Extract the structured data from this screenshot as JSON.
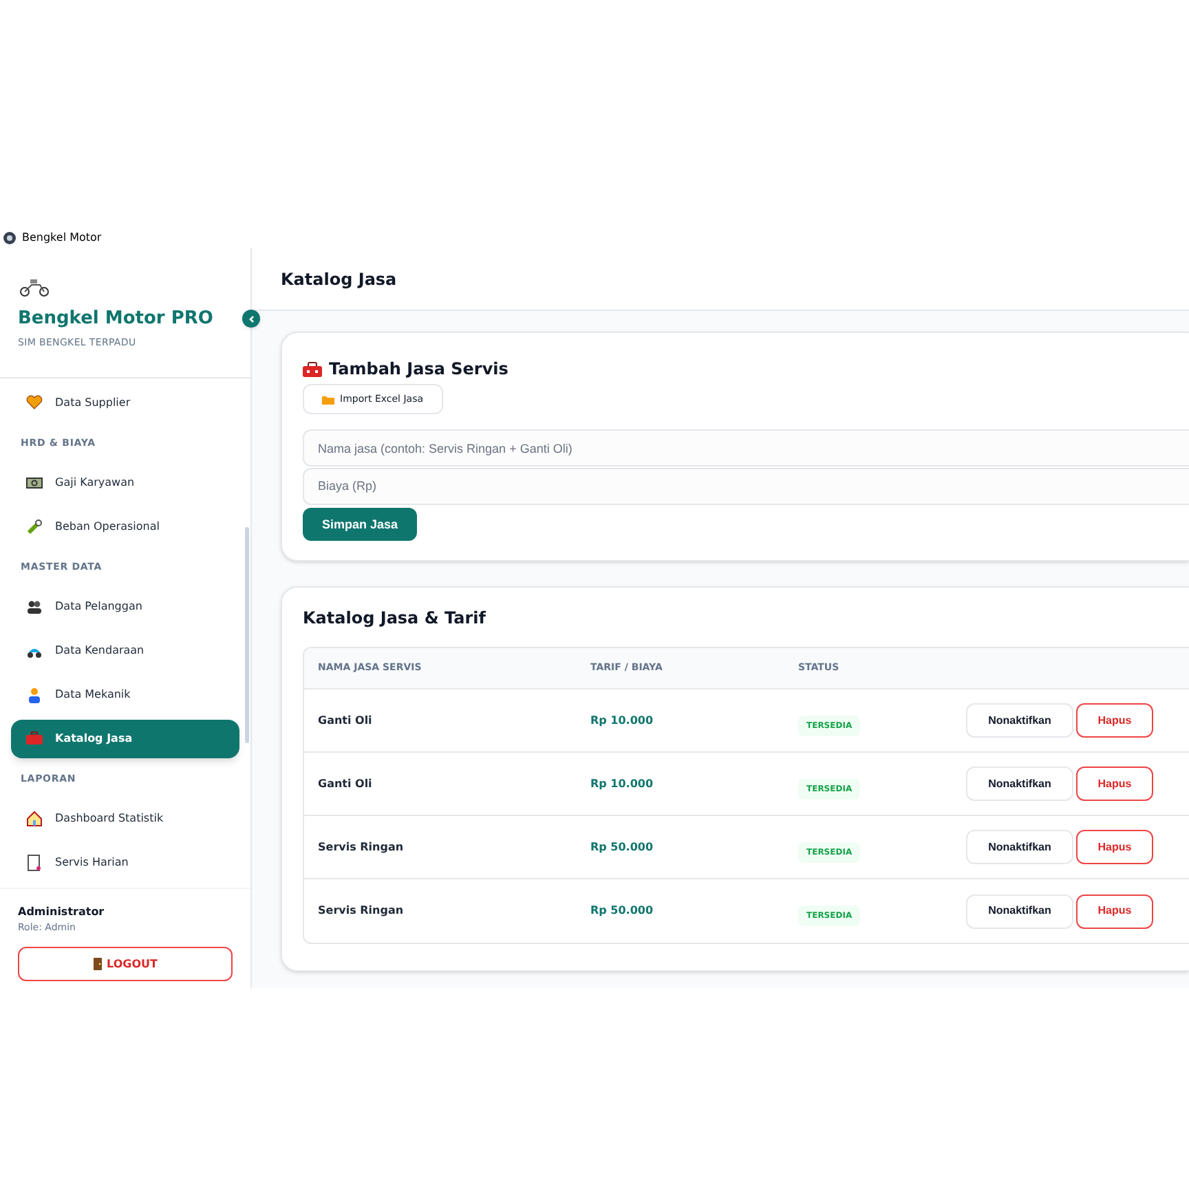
{
  "window": {
    "title": "Bengkel Motor"
  },
  "sidebar": {
    "brand": "Bengkel Motor PRO",
    "subtitle": "SIM BENGKEL TERPADU",
    "items": [
      {
        "kind": "item",
        "label": "Data Supplier",
        "selected": false
      },
      {
        "kind": "section",
        "label": "HRD & BIAYA"
      },
      {
        "kind": "item",
        "label": "Gaji Karyawan",
        "selected": false
      },
      {
        "kind": "item",
        "label": "Beban Operasional",
        "selected": false
      },
      {
        "kind": "section",
        "label": "MASTER DATA"
      },
      {
        "kind": "item",
        "label": "Data Pelanggan",
        "selected": false
      },
      {
        "kind": "item",
        "label": "Data Kendaraan",
        "selected": false
      },
      {
        "kind": "item",
        "label": "Data Mekanik",
        "selected": false
      },
      {
        "kind": "item",
        "label": "Katalog Jasa",
        "selected": true
      },
      {
        "kind": "section",
        "label": "LAPORAN"
      },
      {
        "kind": "item",
        "label": "Dashboard Statistik",
        "selected": false
      },
      {
        "kind": "item",
        "label": "Servis Harian",
        "selected": false
      }
    ],
    "user": {
      "name": "Administrator",
      "role": "Role: Admin"
    },
    "logout": "LOGOUT"
  },
  "page_title": "Katalog Jasa",
  "form": {
    "title": "Tambah Jasa Servis",
    "import_button": "Import Excel Jasa",
    "name_field": {
      "placeholder": "Nama jasa (contoh: Servis Ringan + Ganti Oli)"
    },
    "cost_field": {
      "placeholder": "Biaya (Rp)"
    },
    "submit": "Simpan Jasa"
  },
  "table": {
    "title": "Katalog Jasa & Tarif",
    "columns": [
      "NAMA JASA SERVIS",
      "TARIF / BIAYA",
      "STATUS"
    ],
    "rows": [
      {
        "name": "Ganti Oli",
        "price": "Rp 10.000",
        "status": "TERSEDIA",
        "actions": [
          "Nonaktifkan",
          "Hapus"
        ]
      },
      {
        "name": "Ganti Oli",
        "price": "Rp 10.000",
        "status": "TERSEDIA",
        "actions": [
          "Nonaktifkan",
          "Hapus"
        ]
      },
      {
        "name": "Servis Ringan",
        "price": "Rp 50.000",
        "status": "TERSEDIA",
        "actions": [
          "Nonaktifkan",
          "Hapus"
        ]
      },
      {
        "name": "Servis Ringan",
        "price": "Rp 50.000",
        "status": "TERSEDIA",
        "actions": [
          "Nonaktifkan",
          "Hapus"
        ]
      }
    ]
  }
}
